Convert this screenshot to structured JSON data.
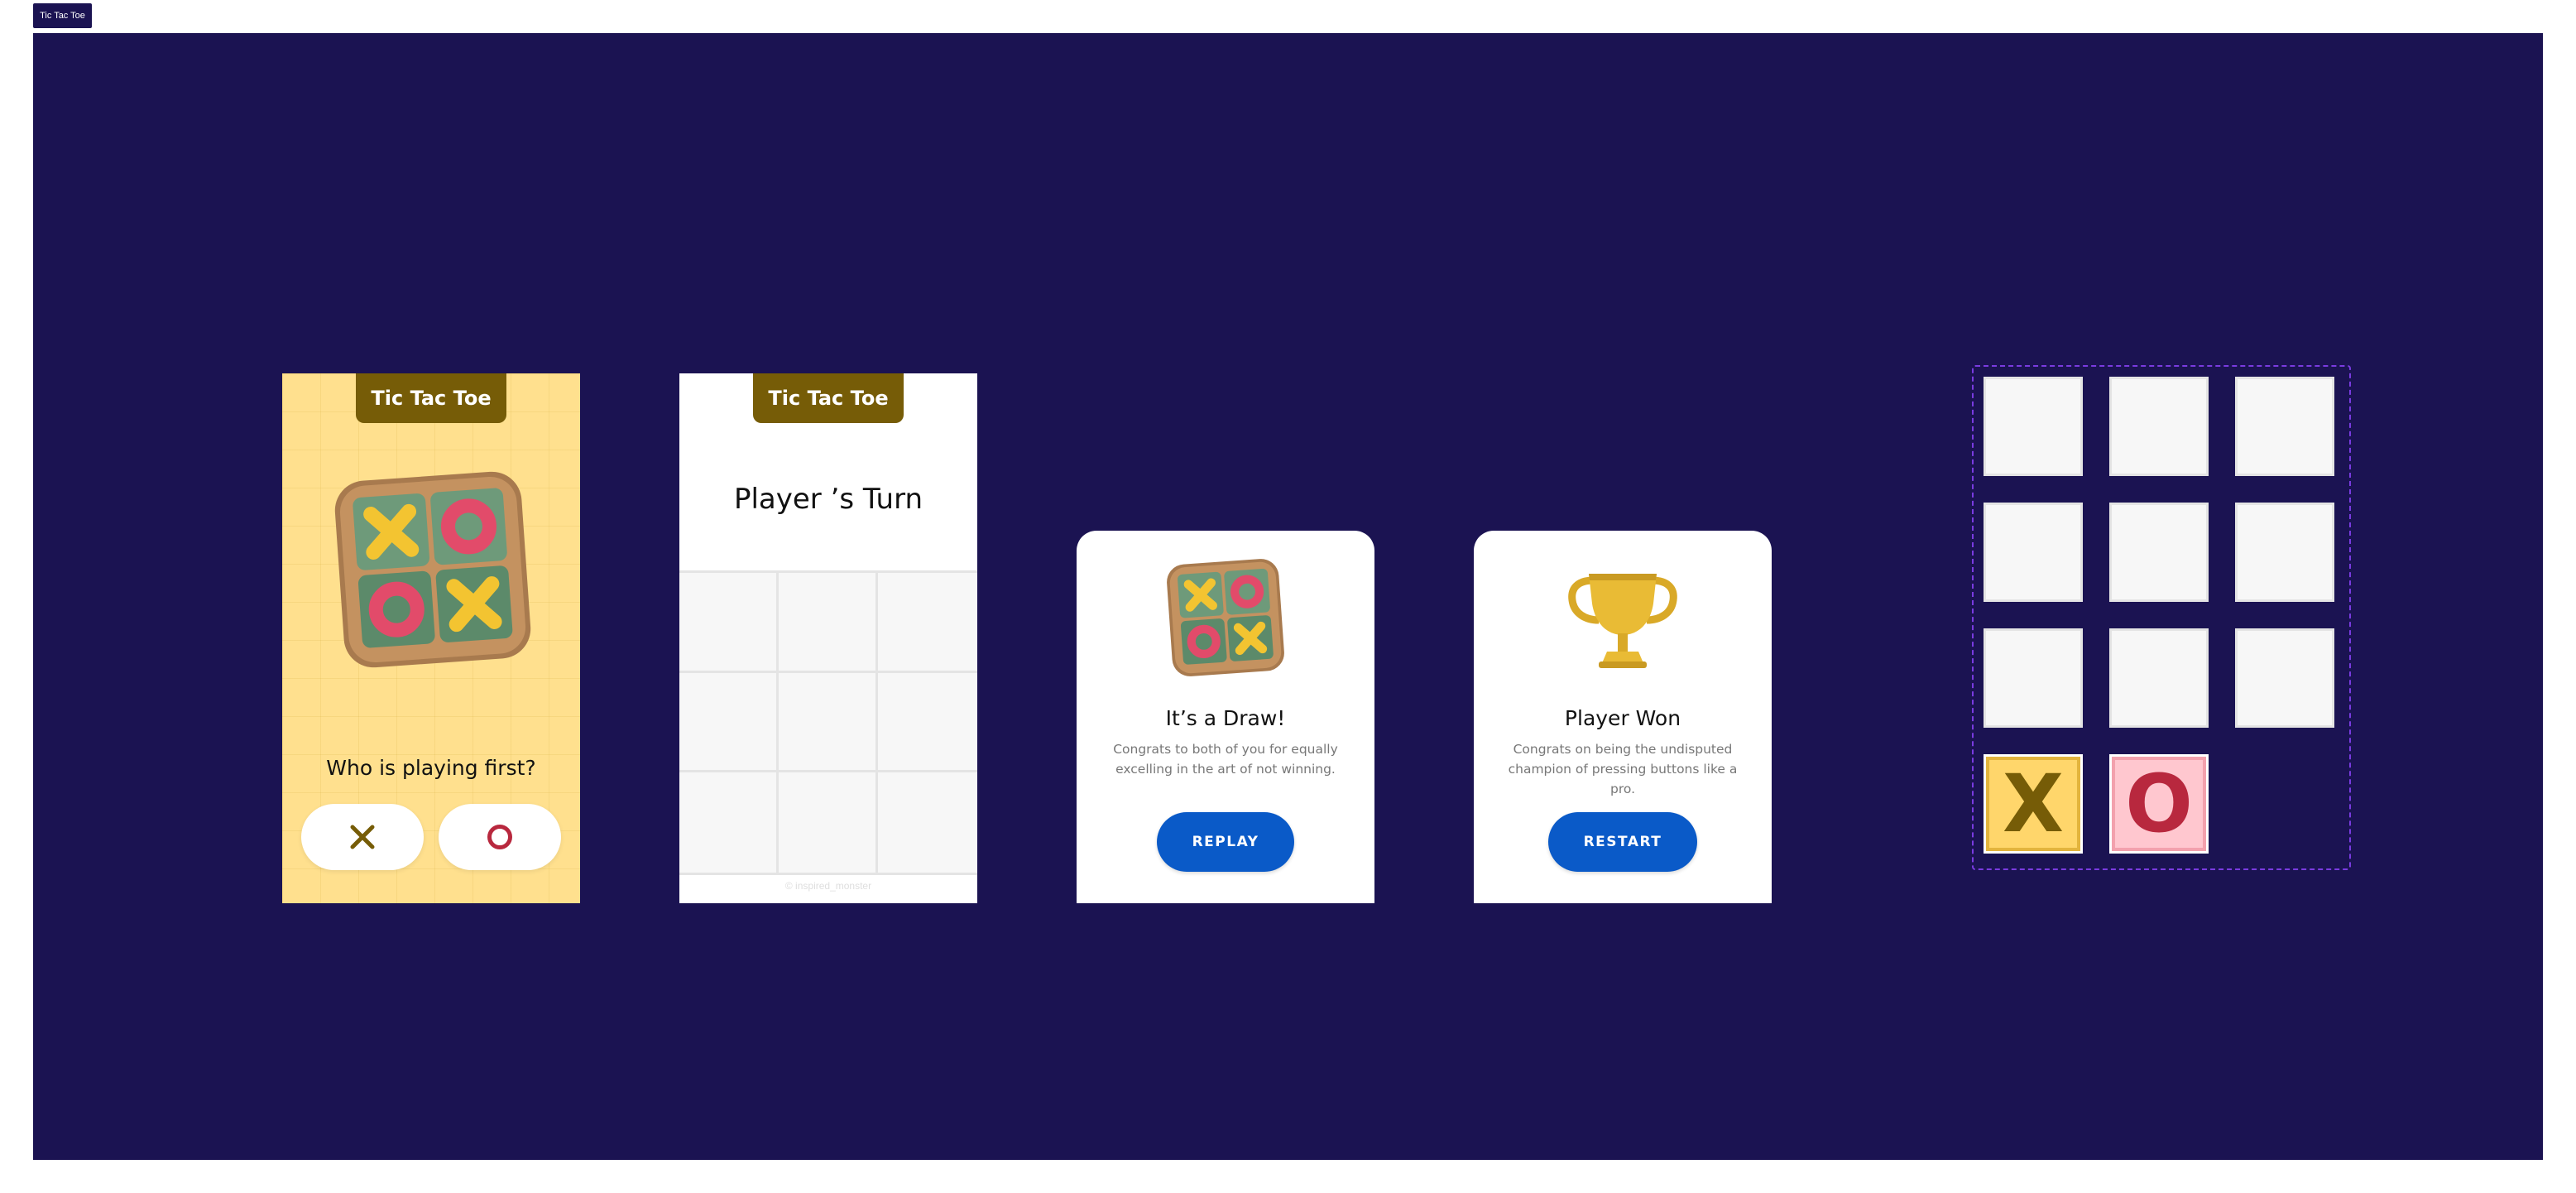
{
  "tab": {
    "label": "Tic Tac Toe"
  },
  "start_screen": {
    "title": "Tic Tac Toe",
    "prompt": "Who is playing first?",
    "options": [
      "x",
      "o"
    ]
  },
  "game_screen": {
    "title": "Tic Tac Toe",
    "turn": "Player ’s Turn",
    "credit": "© inspired_monster"
  },
  "draw_card": {
    "title": "It’s a Draw!",
    "line1": "Congrats to both of you for equally",
    "line2": "excelling in the art of not winning.",
    "button": "REPLAY"
  },
  "win_card": {
    "title": "Player  Won",
    "line1": "Congrats on being the undisputed",
    "line2": "champion of pressing buttons like a pro.",
    "button": "RESTART"
  },
  "components": {
    "x_tile": "X",
    "o_tile": "O",
    "empty_tile_count": 9
  },
  "colors": {
    "canvas": "#1b1352",
    "start_bg": "#ffe08e",
    "title_tab": "#765c07",
    "button_blue": "#0a5ac8",
    "x_color": "#765c07",
    "o_color": "#b8283e",
    "x_tile_bg": "#ffd66b",
    "o_tile_bg": "#ffc7cf"
  },
  "icons": [
    "board-icon",
    "x-mark-icon",
    "o-mark-icon",
    "trophy-icon"
  ]
}
